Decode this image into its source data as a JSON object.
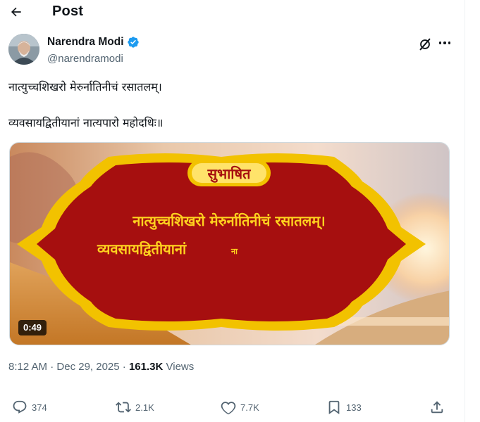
{
  "header": {
    "title": "Post",
    "back_icon": "arrow-left-icon"
  },
  "author": {
    "name": "Narendra Modi",
    "handle": "@narendramodi",
    "verified": true,
    "verified_color": "#1d9bf0"
  },
  "tweet": {
    "line1": "नात्युच्चशिखरो मेरुर्नातिनीचं रसातलम्।",
    "line2": "व्यवसायद्वितीयानां नात्यपारो महोदधिः॥"
  },
  "media": {
    "badge": "सुभाषित",
    "line1": "नात्युच्चशिखरो मेरुर्नातिनीचं रसातलम्।",
    "line2": "व्यवसायद्वितीयानां",
    "line2_tail": "ना",
    "duration": "0:49",
    "colors": {
      "frame": "#f2c200",
      "panel": "#a60f0f",
      "text": "#ffd21f"
    }
  },
  "meta": {
    "time": "8:12 AM",
    "separator": "·",
    "date": "Dec 29, 2025",
    "views_count": "161.3K",
    "views_label": "Views"
  },
  "actions": {
    "replies": "374",
    "reposts": "2.1K",
    "likes": "7.7K",
    "bookmarks": "133"
  },
  "colors": {
    "text": "#0f1419",
    "secondary": "#536471"
  }
}
